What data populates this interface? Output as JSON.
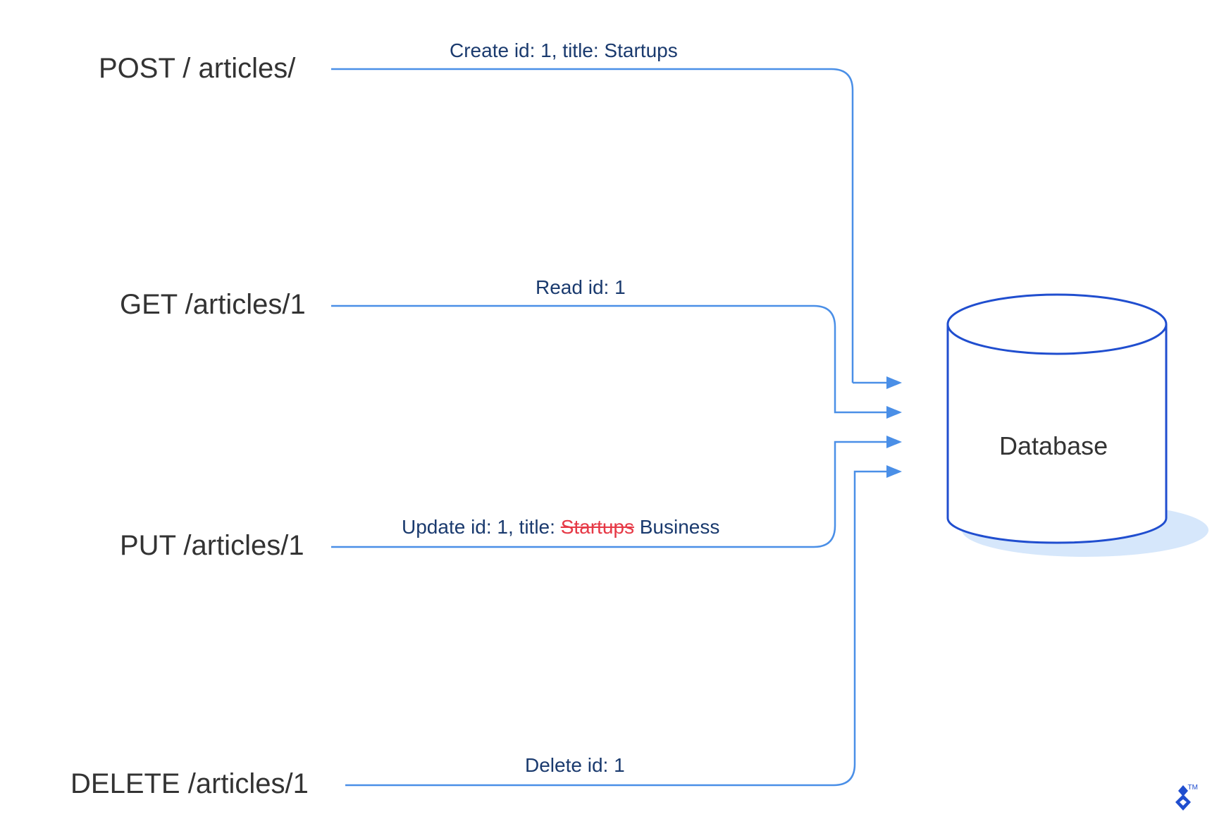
{
  "methods": {
    "post": "POST / articles/",
    "get": "GET /articles/1",
    "put": "PUT /articles/1",
    "delete": "DELETE /articles/1"
  },
  "actions": {
    "create": "Create id: 1, title: Startups",
    "read": "Read id: 1",
    "update_prefix": "Update id: 1, title: ",
    "update_old": "Startups",
    "update_new": " Business",
    "delete": "Delete id: 1"
  },
  "database": {
    "label": "Database"
  },
  "logo": {
    "tm": "TM"
  },
  "colors": {
    "accent": "#4a8fe7",
    "text_dark": "#333333",
    "text_primary": "#1a3a6e",
    "strikethrough": "#e63946",
    "brand": "#204ecf",
    "shadow": "#d6e7fb"
  }
}
